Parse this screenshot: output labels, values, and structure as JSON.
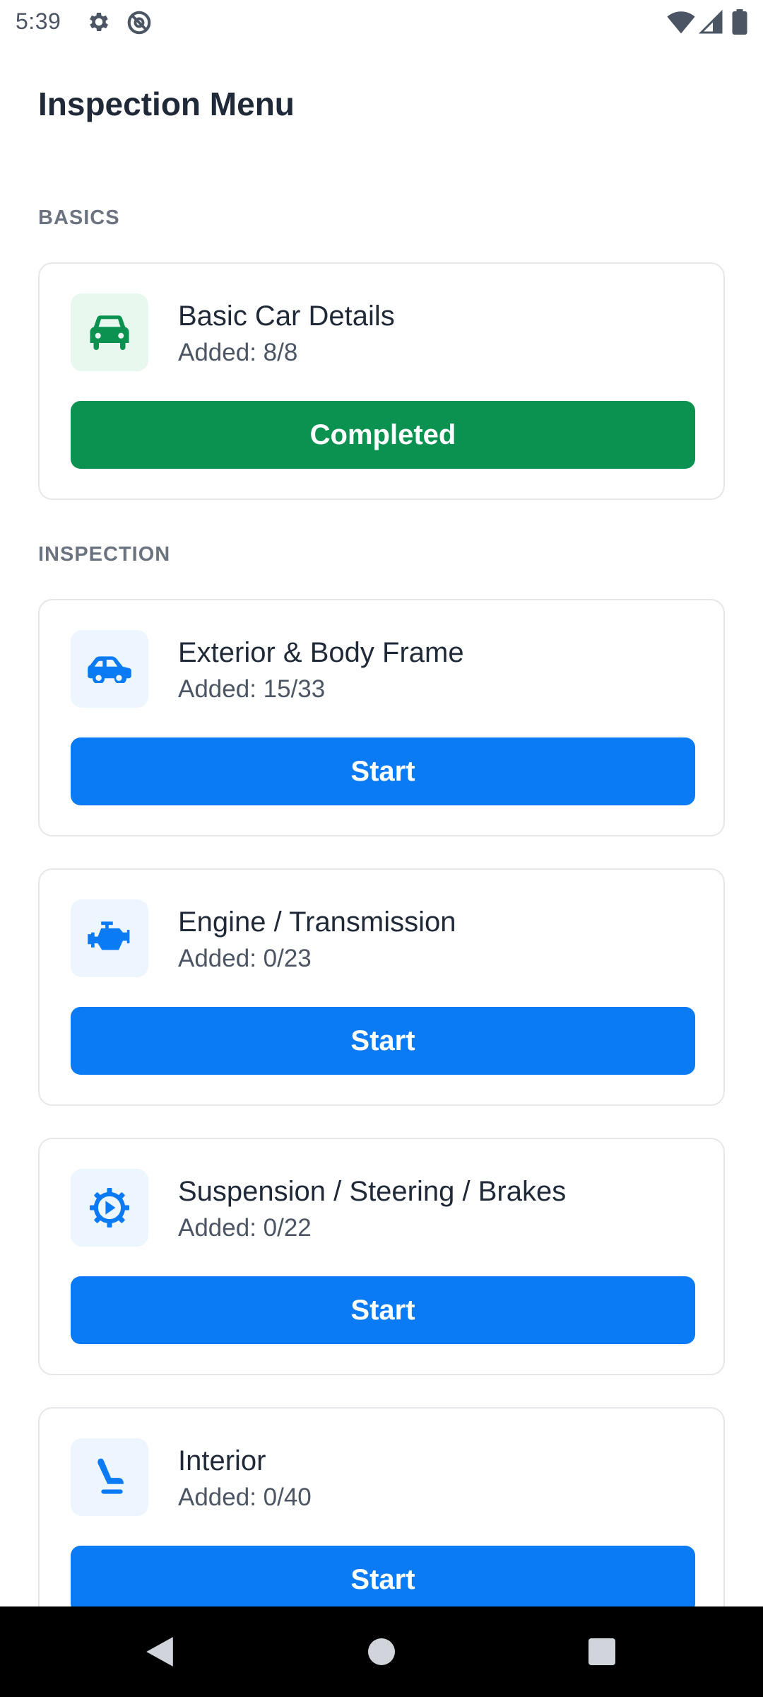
{
  "status_bar": {
    "time": "5:39",
    "left_icons": [
      "gear-icon",
      "at-sign-icon"
    ],
    "right_icons": [
      "wifi-icon",
      "signal-icon",
      "battery-icon"
    ]
  },
  "header": {
    "title": "Inspection Menu"
  },
  "sections": [
    {
      "label": "BASICS"
    },
    {
      "label": "INSPECTION"
    }
  ],
  "cards": [
    {
      "title": "Basic Car Details",
      "subtitle": "Added: 8/8",
      "button": "Completed",
      "icon": "car-front-icon",
      "progress": 1.0
    },
    {
      "title": "Exterior & Body Frame",
      "subtitle": "Added: 15/33",
      "button": "Start",
      "icon": "car-side-icon",
      "progress": 0.4545
    },
    {
      "title": "Engine / Transmission",
      "subtitle": "Added: 0/23",
      "button": "Start",
      "icon": "engine-icon",
      "progress": 0
    },
    {
      "title": "Suspension / Steering / Brakes",
      "subtitle": "Added: 0/22",
      "button": "Start",
      "icon": "steering-wheel-icon",
      "progress": 0
    },
    {
      "title": "Interior",
      "subtitle": "Added: 0/40",
      "button": "Start",
      "icon": "car-seat-icon",
      "progress": 0
    }
  ],
  "colors": {
    "completed_green": "#0b9150",
    "start_blue": "#0a7bf5",
    "icon_green": "#0b9150",
    "icon_blue": "#0a7bf5"
  },
  "nav_bar": {
    "buttons": [
      "back-icon",
      "home-icon",
      "recents-icon"
    ]
  }
}
